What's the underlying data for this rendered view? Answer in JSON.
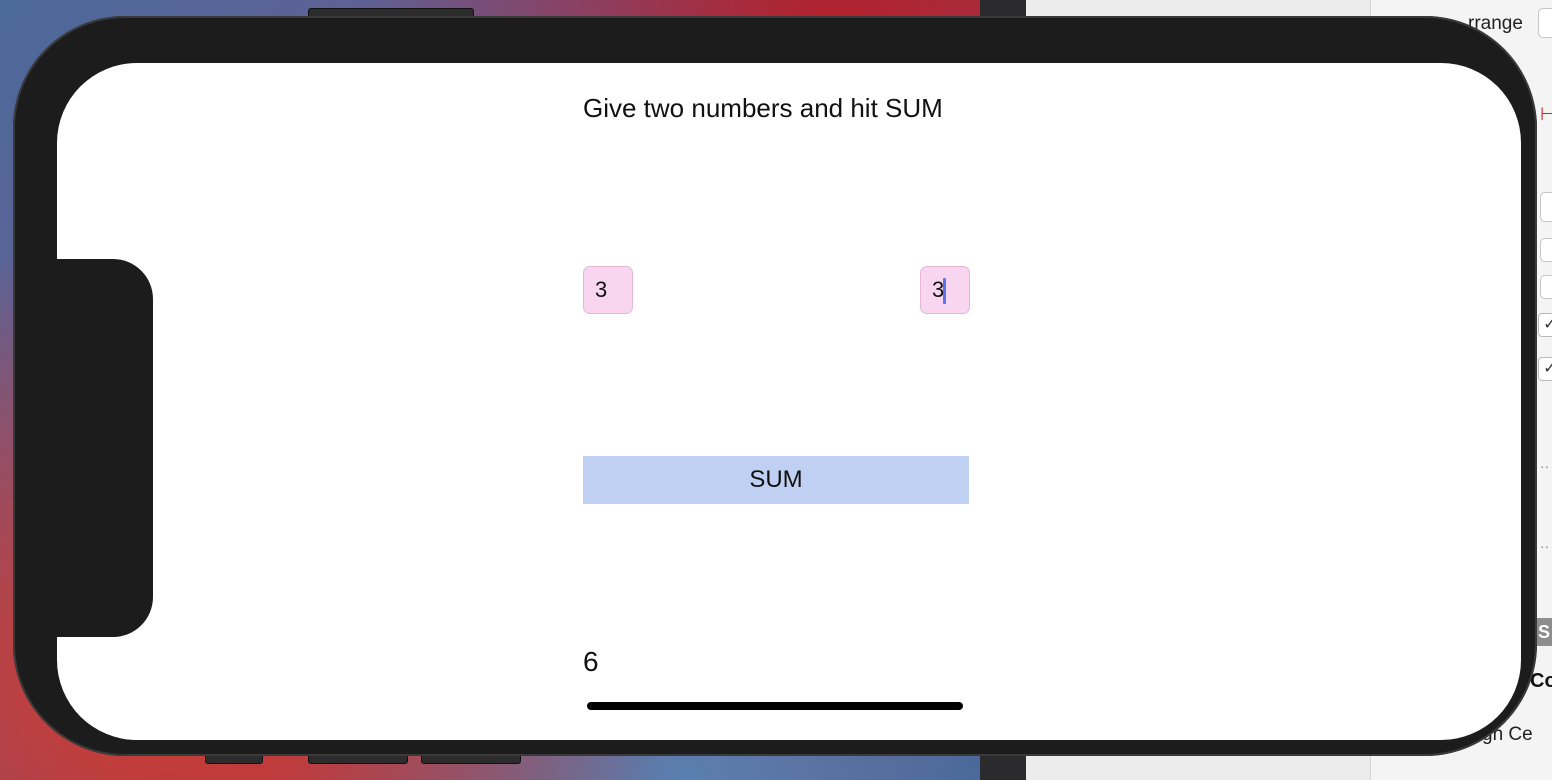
{
  "app": {
    "title": "Give two numbers and hit SUM",
    "first_number": "3",
    "second_number": "3",
    "sum_button_label": "SUM",
    "result": "6"
  },
  "inspector": {
    "arrange_label": "rrange",
    "section_heading": "Co",
    "section_bar_label": "S",
    "align_label": "gn Ce",
    "red_marker": "⊢"
  },
  "colors": {
    "input_fill": "#f8d6ef",
    "button_fill": "#c0d0f2",
    "caret": "#5a72f0"
  }
}
